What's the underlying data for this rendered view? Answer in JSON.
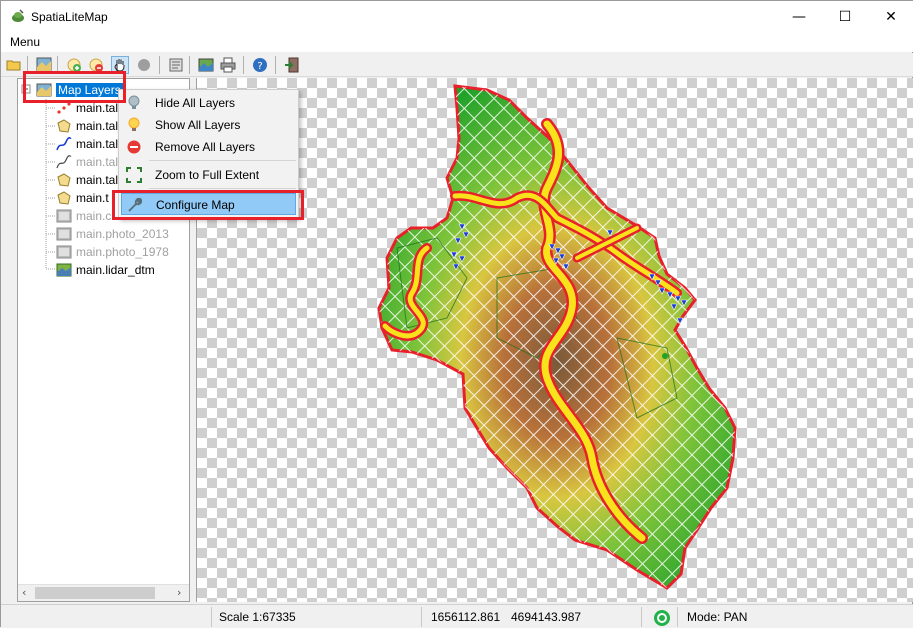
{
  "window": {
    "title": "SpatiaLiteMap",
    "minimize_glyph": "—",
    "maximize_glyph": "☐",
    "close_glyph": "✕"
  },
  "menubar": {
    "menu_label": "Menu"
  },
  "toolbar": {
    "icons": [
      "open-folder-icon",
      "map-icon",
      "add-layer-icon",
      "remove-layer-icon",
      "pan-hand-icon",
      "record-icon",
      "properties-icon",
      "image-icon",
      "print-icon",
      "help-icon",
      "exit-icon"
    ]
  },
  "tree": {
    "root_label": "Map Layers",
    "items": [
      {
        "label": "main.tal",
        "icon": "point-layer-icon",
        "dimmed": false
      },
      {
        "label": "main.tal",
        "icon": "polygon-layer-icon",
        "dimmed": false
      },
      {
        "label": "main.tal",
        "icon": "line-layer-icon",
        "dimmed": false
      },
      {
        "label": "main.tal",
        "icon": "line-layer-icon",
        "dimmed": true
      },
      {
        "label": "main.tal",
        "icon": "polygon-layer-icon",
        "dimmed": false
      },
      {
        "label": "main.t",
        "icon": "polygon-layer-icon",
        "dimmed": false
      },
      {
        "label": "main.c",
        "icon": "raster-layer-icon",
        "dimmed": true
      },
      {
        "label": "main.photo_2013",
        "icon": "raster-layer-icon",
        "dimmed": true
      },
      {
        "label": "main.photo_1978",
        "icon": "raster-layer-icon",
        "dimmed": true
      },
      {
        "label": "main.lidar_dtm",
        "icon": "raster-layer-icon",
        "dimmed": false
      }
    ]
  },
  "context_menu": {
    "items": [
      {
        "label": "Hide All Layers",
        "icon": "bulb-off-icon"
      },
      {
        "label": "Show All Layers",
        "icon": "bulb-on-icon"
      },
      {
        "label": "Remove All Layers",
        "icon": "remove-icon"
      },
      {
        "label": "Zoom to Full Extent",
        "icon": "zoom-extent-icon"
      },
      {
        "label": "Configure Map",
        "icon": "wrench-icon"
      }
    ]
  },
  "statusbar": {
    "scale": "Scale 1:67335",
    "x": "1656112.861",
    "y": "4694143.987",
    "mode": "Mode: PAN"
  },
  "colors": {
    "highlight": "#91c9f7",
    "annotation_red": "#e8202a",
    "selection_blue": "#0078d7"
  }
}
